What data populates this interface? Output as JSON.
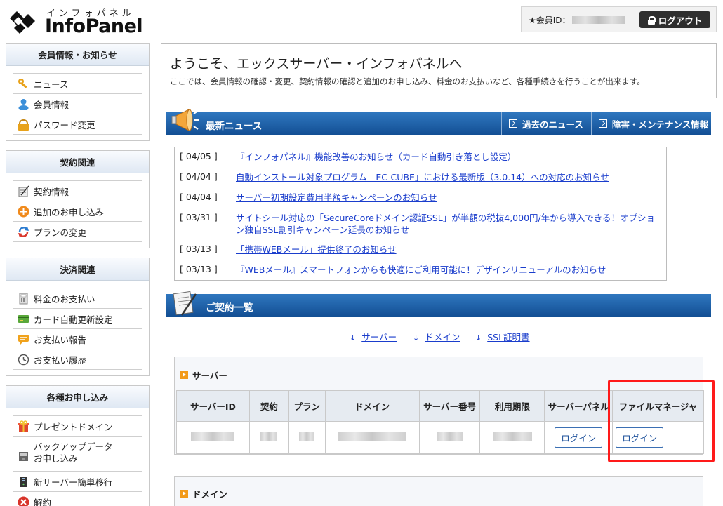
{
  "logo": {
    "kana": "インフォパネル",
    "text": "InfoPanel"
  },
  "member": {
    "label": "★会員ID：",
    "logout_label": "ログアウト"
  },
  "sidebar": [
    {
      "title": "会員情報・お知らせ",
      "items": [
        {
          "label": "ニュース",
          "icon": "key-icon"
        },
        {
          "label": "会員情報",
          "icon": "user-icon"
        },
        {
          "label": "パスワード変更",
          "icon": "lock-icon"
        }
      ]
    },
    {
      "title": "契約関連",
      "items": [
        {
          "label": "契約情報",
          "icon": "contract-icon"
        },
        {
          "label": "追加のお申し込み",
          "icon": "plus-circle-icon"
        },
        {
          "label": "プランの変更",
          "icon": "refresh-icon"
        }
      ]
    },
    {
      "title": "決済関連",
      "items": [
        {
          "label": "料金のお支払い",
          "icon": "calculator-icon"
        },
        {
          "label": "カード自動更新設定",
          "icon": "credit-card-icon"
        },
        {
          "label": "お支払い報告",
          "icon": "comment-icon"
        },
        {
          "label": "お支払い履歴",
          "icon": "clock-icon"
        }
      ]
    },
    {
      "title": "各種お申し込み",
      "items": [
        {
          "label": "プレゼントドメイン",
          "icon": "gift-icon"
        },
        {
          "label_line1": "バックアップデータ",
          "label_line2": "お申し込み",
          "icon": "backup-icon"
        },
        {
          "label": "新サーバー簡単移行",
          "icon": "server-icon"
        },
        {
          "label": "解約",
          "icon": "cancel-icon"
        }
      ]
    }
  ],
  "welcome": {
    "title": "ようこそ、エックスサーバー・インフォパネルへ",
    "subtitle": "ここでは、会員情報の確認・変更、契約情報の確認と追加のお申し込み、料金のお支払いなど、各種手続きを行うことが出来ます。"
  },
  "news": {
    "title": "最新ニュース",
    "past_link": "過去のニュース",
    "maintenance_link": "障害・メンテナンス情報",
    "items": [
      {
        "date": "[ 04/05 ]",
        "text": "『インフォパネル』機能改善のお知らせ（カード自動引き落とし設定）"
      },
      {
        "date": "[ 04/04 ]",
        "text": "自動インストール対象プログラム「EC-CUBE」における最新版（3.0.14）への対応のお知らせ"
      },
      {
        "date": "[ 04/04 ]",
        "text": "サーバー初期設定費用半額キャンペーンのお知らせ"
      },
      {
        "date": "[ 03/31 ]",
        "text": "サイトシール対応の「SecureCoreドメイン認証SSL」が半額の税抜4,000円/年から導入できる！オプション独自SSL割引キャンペーン延長のお知らせ"
      },
      {
        "date": "[ 03/13 ]",
        "text": "「携帯WEBメール」提供終了のお知らせ"
      },
      {
        "date": "[ 03/13 ]",
        "text": "『WEBメール』スマートフォンからも快適にご利用可能に！デザインリニューアルのお知らせ"
      }
    ]
  },
  "contracts": {
    "title": "ご契約一覧",
    "anchors": [
      "サーバー",
      "ドメイン",
      "SSL証明書"
    ],
    "server_title": "サーバー",
    "columns": [
      "サーバーID",
      "契約",
      "プラン",
      "ドメイン",
      "サーバー番号",
      "利用期限",
      "サーバーパネル",
      "ファイルマネージャ"
    ],
    "server_panel_login": "ログイン",
    "file_manager_login": "ログイン",
    "domain_title": "ドメイン"
  }
}
